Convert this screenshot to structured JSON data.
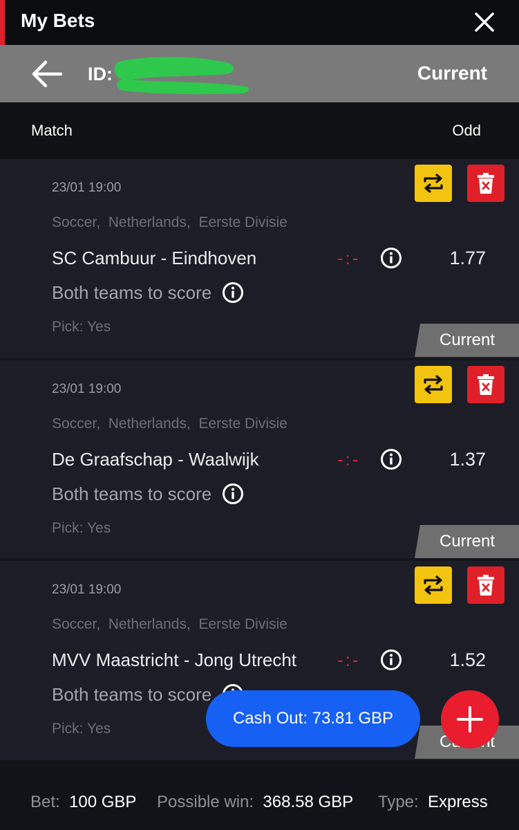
{
  "header": {
    "title": "My Bets",
    "close_icon": "close-icon"
  },
  "ticket": {
    "id_label": "ID:",
    "status": "Current"
  },
  "columns": {
    "match": "Match",
    "odd": "Odd"
  },
  "bets": [
    {
      "date": "23/01 19:00",
      "sport": "Soccer,",
      "country": "Netherlands,",
      "league": "Eerste Divisie",
      "teams": "SC Cambuur - Eindhoven",
      "score": "-:-",
      "odd": "1.77",
      "market": "Both teams to score",
      "pick": "Pick: Yes",
      "status": "Current"
    },
    {
      "date": "23/01 19:00",
      "sport": "Soccer,",
      "country": "Netherlands,",
      "league": "Eerste Divisie",
      "teams": "De Graafschap - Waalwijk",
      "score": "-:-",
      "odd": "1.37",
      "market": "Both teams to score",
      "pick": "Pick: Yes",
      "status": "Current"
    },
    {
      "date": "23/01 19:00",
      "sport": "Soccer,",
      "country": "Netherlands,",
      "league": "Eerste Divisie",
      "teams": "MVV Maastricht - Jong Utrecht",
      "score": "-:-",
      "odd": "1.52",
      "market": "Both teams to score",
      "pick": "Pick: Yes",
      "status": "Current"
    }
  ],
  "cashout_label": "Cash Out: 73.81 GBP",
  "footer": {
    "bet_label": "Bet:",
    "bet_value": "100 GBP",
    "win_label": "Possible win:",
    "win_value": "368.58 GBP",
    "type_label": "Type:",
    "type_value": "Express"
  },
  "colors": {
    "accent_red": "#e0202c",
    "swap_yellow": "#f2c40f",
    "cashout_blue": "#1660f4",
    "card_bg": "#1c1d27"
  }
}
